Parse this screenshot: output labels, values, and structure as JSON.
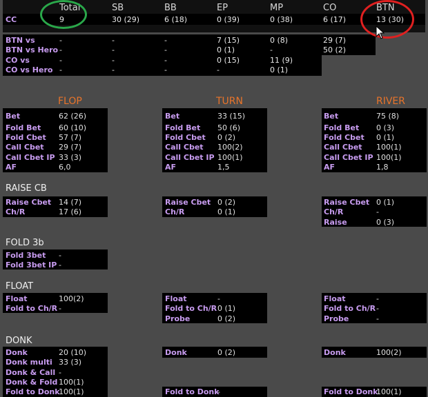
{
  "header": {
    "columns": [
      "Total",
      "SB",
      "BB",
      "EP",
      "MP",
      "CO",
      "BTN"
    ]
  },
  "cc_row": {
    "label": "CC",
    "values": [
      "9",
      "30 (29)",
      "6 (18)",
      "0 (39)",
      "0 (38)",
      "6 (17)",
      "13 (30)"
    ]
  },
  "vs_rows": [
    {
      "label": "BTN vs",
      "values": [
        "-",
        "-",
        "-",
        "7 (15)",
        "0 (8)",
        "29 (7)"
      ]
    },
    {
      "label": "BTN vs Hero",
      "values": [
        "-",
        "-",
        "-",
        "0 (1)",
        "-",
        "50 (2)"
      ]
    },
    {
      "label": "CO vs",
      "values": [
        "-",
        "-",
        "-",
        "0 (15)",
        "11 (9)",
        ""
      ]
    },
    {
      "label": "CO vs Hero",
      "values": [
        "-",
        "-",
        "-",
        "-",
        "0 (1)",
        ""
      ]
    }
  ],
  "streets": {
    "flop": "FLOP",
    "turn": "TURN",
    "river": "RIVER"
  },
  "cbet": {
    "labels": [
      "Bet",
      "Fold Bet",
      "Fold Cbet",
      "Call Cbet",
      "Call Cbet IP",
      "AF"
    ],
    "flop": [
      "62 (26)",
      "60 (10)",
      "57 (7)",
      "29 (7)",
      "33 (3)",
      "6,0"
    ],
    "turn": [
      "33 (15)",
      "50 (6)",
      "0 (2)",
      "100(2)",
      "100(1)",
      "1,5"
    ],
    "river": [
      "75 (8)",
      "0 (3)",
      "0 (1)",
      "100(1)",
      "100(1)",
      "1,8"
    ]
  },
  "raise_cb": {
    "title": "RAISE CB",
    "flop": [
      {
        "label": "Raise Cbet",
        "value": "14 (7)"
      },
      {
        "label": "Ch/R",
        "value": "17 (6)"
      }
    ],
    "turn": [
      {
        "label": "Raise Cbet",
        "value": "0 (2)"
      },
      {
        "label": "Ch/R",
        "value": "0 (1)"
      }
    ],
    "river": [
      {
        "label": "Raise Cbet",
        "value": "0 (1)"
      },
      {
        "label": "Ch/R",
        "value": "-"
      },
      {
        "label": "Raise",
        "value": "0 (3)"
      }
    ]
  },
  "fold3b": {
    "title": "FOLD 3b",
    "rows": [
      {
        "label": "Fold 3bet",
        "value": "-"
      },
      {
        "label": "Fold 3bet IP",
        "value": "-"
      }
    ]
  },
  "float": {
    "title": "FLOAT",
    "flop": [
      {
        "label": "Float",
        "value": "100(2)"
      },
      {
        "label": "Fold to Ch/R",
        "value": "-"
      }
    ],
    "turn": [
      {
        "label": "Float",
        "value": "-"
      },
      {
        "label": "Fold to Ch/R",
        "value": "0 (1)"
      },
      {
        "label": "Probe",
        "value": "0 (2)"
      }
    ],
    "river": [
      {
        "label": "Float",
        "value": "-"
      },
      {
        "label": "Fold to Ch/R",
        "value": "-"
      },
      {
        "label": "Probe",
        "value": "-"
      }
    ]
  },
  "donk": {
    "title": "DONK",
    "flop": [
      {
        "label": "Donk",
        "value": "20 (10)"
      },
      {
        "label": "Donk multi",
        "value": "33 (3)"
      },
      {
        "label": "Donk & Call",
        "value": "-"
      },
      {
        "label": "Donk & Fold",
        "value": "100(1)"
      },
      {
        "label": "Fold to Donk",
        "value": "100(1)"
      }
    ],
    "turn": [
      {
        "label": "Donk",
        "value": "0 (2)"
      },
      {
        "label": "Fold to Donk",
        "value": "-"
      }
    ],
    "river": [
      {
        "label": "Donk",
        "value": "100(2)"
      },
      {
        "label": "Fold to Donk",
        "value": "100(1)"
      }
    ]
  },
  "colors": {
    "label": "#c89cf0",
    "street": "#e8742a",
    "panel": "#000000",
    "background": "#4a4a4a",
    "green_circle": "#2aa84a",
    "red_circle": "#e02020"
  }
}
